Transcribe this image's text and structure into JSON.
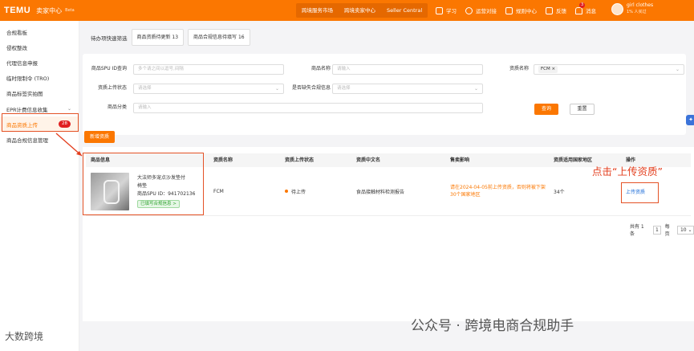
{
  "header": {
    "logo": "TEMU",
    "app_name": "卖家中心",
    "beta": "Beta",
    "tabs": [
      "跨境服务市场",
      "跨境卖家中心",
      "Seller Central"
    ],
    "links": [
      {
        "label": "学习",
        "icon": "book-icon"
      },
      {
        "label": "运营对接",
        "icon": "headset-icon"
      },
      {
        "label": "规则中心",
        "icon": "rules-icon"
      },
      {
        "label": "反馈",
        "icon": "feedback-icon"
      }
    ],
    "messages": {
      "label": "消息",
      "count": "3",
      "icon": "bell-icon"
    },
    "user": {
      "name": "girl clothes",
      "sub": "1% 人买过"
    }
  },
  "sidebar": {
    "items": [
      {
        "label": "合规看板"
      },
      {
        "label": "侵权整改"
      },
      {
        "label": "代理信息申报"
      },
      {
        "label": "临时限制令 (TRO)"
      },
      {
        "label": "商品标签实拍图"
      },
      {
        "label": "EPR计费信息收集",
        "chevron": "⌄"
      },
      {
        "label": "商品资质上传",
        "count": "28"
      },
      {
        "label": "商品合规信息管理"
      }
    ]
  },
  "quick_filter": {
    "label": "待办项快速筛选",
    "chips": [
      "商品资质待更新 13",
      "商品合规信息待填写 16"
    ]
  },
  "filters": {
    "spu_label": "商品SPU ID查询",
    "spu_placeholder": "多个请之间以逗号,间隔",
    "name_label": "商品名称",
    "name_placeholder": "请输入",
    "qual_label": "资质名称",
    "qual_tag": "FCM ×",
    "upload_status_label": "资质上传状态",
    "upload_status_placeholder": "请选择",
    "missing_label": "是否缺失合规信息",
    "missing_placeholder": "请选择",
    "category_label": "商品分类",
    "category_placeholder": "请输入",
    "query_btn": "查询",
    "reset_btn": "重置"
  },
  "add_btn": "新增资质",
  "table": {
    "headers": [
      "商品信息",
      "资质名称",
      "资质上传状态",
      "资质中文名",
      "售卖影响",
      "资质适用国家地区",
      "操作"
    ],
    "row": {
      "product_title_1": "大法师多宠点沙发垫付",
      "product_title_2": "椅垫",
      "spu": "商品SPU ID：941702136",
      "compliance": "已填写合规信息 >",
      "qual_name": "FCM",
      "status": "待上传",
      "qual_cn": "食品接触材料检测报告",
      "impact": "请在2024-04-05前上传资质，否则将被下架30个国家地区",
      "regions": "34个",
      "action": "上传资质"
    }
  },
  "annotation": "点击“上传资质”",
  "pagination": {
    "total": "共有 1 条",
    "page": "1",
    "per_label": "每页",
    "per": "10"
  },
  "watermark": {
    "left": "大数跨境",
    "right": "公众号 · 跨境电商合规助手"
  }
}
